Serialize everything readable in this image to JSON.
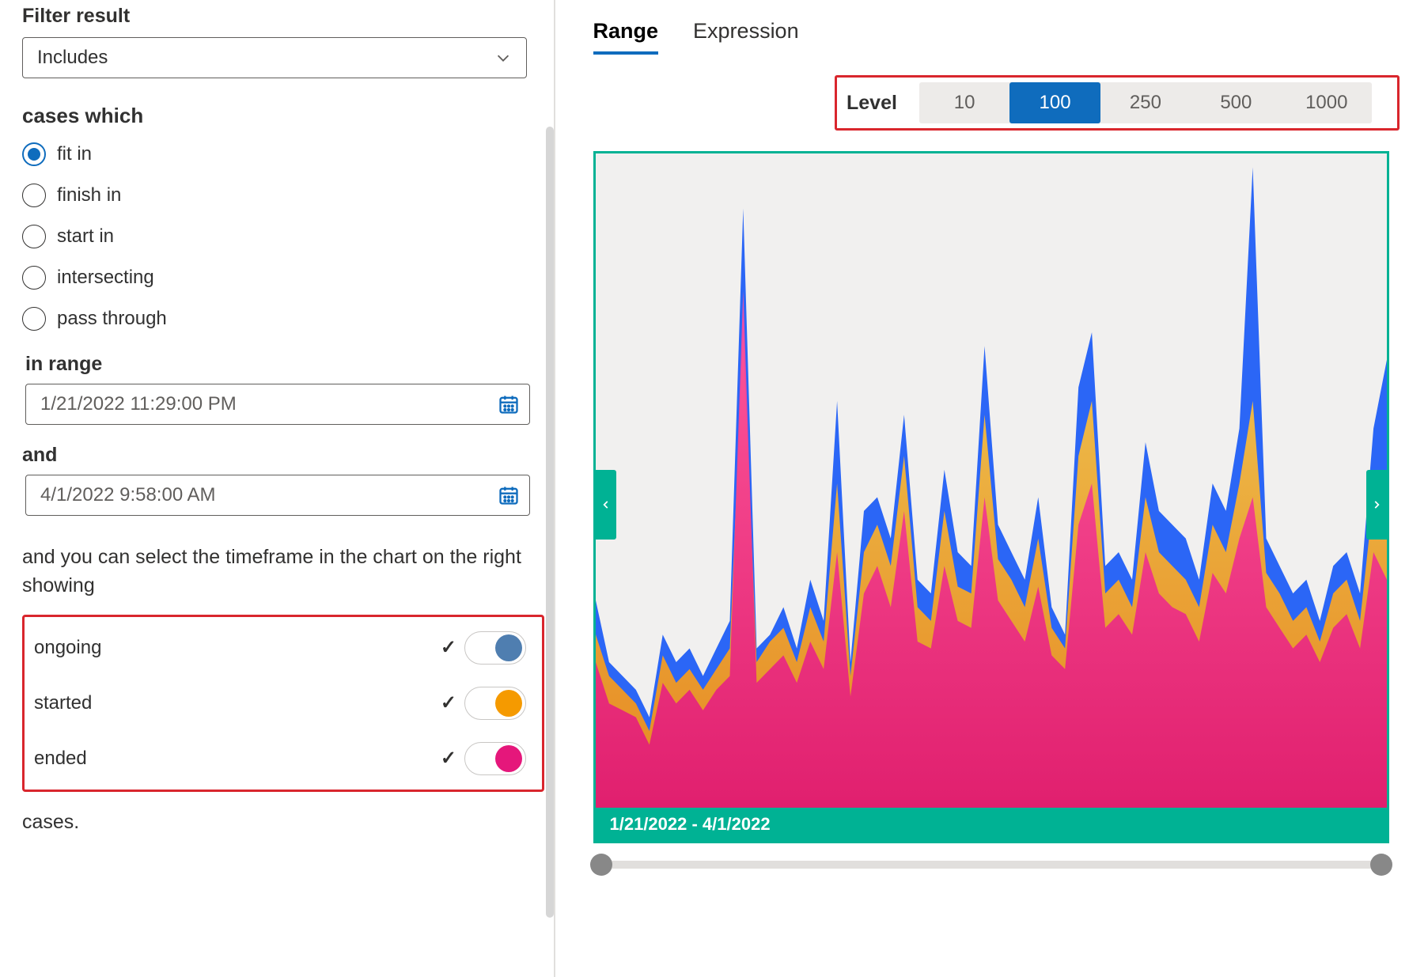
{
  "left": {
    "filter_result_label": "Filter result",
    "filter_result_value": "Includes",
    "cases_which_label": "cases which",
    "radios": {
      "fit_in": "fit in",
      "finish_in": "finish in",
      "start_in": "start in",
      "intersecting": "intersecting",
      "pass_through": "pass through"
    },
    "in_range_label": "in range",
    "date_from": "1/21/2022 11:29:00 PM",
    "and_label": "and",
    "date_to": "4/1/2022 9:58:00 AM",
    "desc": "and you can select the timeframe in the chart on the right showing",
    "legend": {
      "ongoing": "ongoing",
      "started": "started",
      "ended": "ended"
    },
    "trailing": "cases."
  },
  "right": {
    "tab_range": "Range",
    "tab_expression": "Expression",
    "level_label": "Level",
    "levels": {
      "l10": "10",
      "l100": "100",
      "l250": "250",
      "l500": "500",
      "l1000": "1000"
    },
    "date_banner": "1/21/2022 - 4/1/2022"
  },
  "chart_data": {
    "type": "area",
    "xlabel": "",
    "ylabel": "",
    "x_range_label": "1/21/2022 - 4/1/2022",
    "ylim": [
      0,
      100
    ],
    "series": [
      {
        "name": "ongoing",
        "color": "#2b66f6",
        "values": [
          35,
          26,
          24,
          22,
          18,
          30,
          26,
          28,
          24,
          28,
          32,
          92,
          28,
          30,
          34,
          28,
          38,
          32,
          64,
          26,
          48,
          50,
          44,
          62,
          38,
          36,
          54,
          42,
          40,
          72,
          46,
          42,
          38,
          50,
          34,
          30,
          66,
          74,
          40,
          42,
          38,
          58,
          48,
          46,
          44,
          38,
          52,
          48,
          60,
          98,
          44,
          40,
          36,
          38,
          32,
          40,
          42,
          36,
          60,
          70
        ]
      },
      {
        "name": "started",
        "color": "#f59a00",
        "values": [
          30,
          24,
          22,
          20,
          16,
          27,
          23,
          25,
          22,
          25,
          28,
          74,
          26,
          29,
          31,
          26,
          34,
          29,
          52,
          24,
          42,
          46,
          40,
          56,
          34,
          32,
          48,
          37,
          36,
          62,
          41,
          38,
          34,
          44,
          31,
          28,
          56,
          64,
          36,
          38,
          34,
          50,
          42,
          40,
          38,
          34,
          46,
          42,
          52,
          64,
          39,
          36,
          32,
          34,
          29,
          36,
          38,
          32,
          50,
          48
        ]
      },
      {
        "name": "ended",
        "color": "#e5177b",
        "values": [
          26,
          20,
          19,
          18,
          14,
          23,
          20,
          22,
          19,
          22,
          24,
          80,
          23,
          25,
          27,
          23,
          29,
          25,
          42,
          21,
          36,
          40,
          34,
          48,
          29,
          28,
          40,
          32,
          31,
          50,
          35,
          32,
          29,
          37,
          27,
          25,
          46,
          52,
          31,
          33,
          30,
          42,
          36,
          34,
          33,
          29,
          39,
          36,
          44,
          50,
          34,
          31,
          28,
          30,
          26,
          31,
          33,
          28,
          42,
          38
        ]
      }
    ]
  }
}
